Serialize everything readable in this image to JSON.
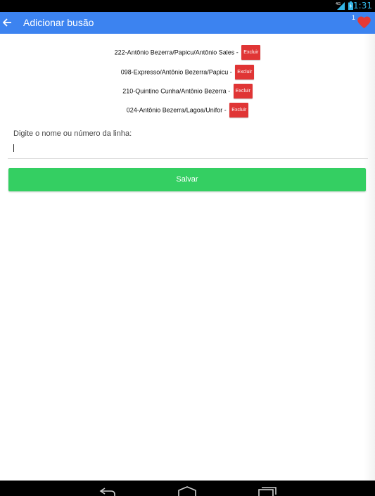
{
  "status_bar": {
    "network_label": "4G",
    "time": "1:31"
  },
  "app_bar": {
    "back_icon": "arrow-left-icon",
    "title": "Adicionar busão",
    "favorite_count": "1",
    "favorite_icon": "heart-icon"
  },
  "bus_lines": [
    {
      "name": "222-Antônio Bezerra/Papicu/Antônio Sales -",
      "delete_label": "Excluir"
    },
    {
      "name": "098-Expresso/Antônio Bezerra/Papicu -",
      "delete_label": "Excluir"
    },
    {
      "name": "210-Quintino Cunha/Antônio Bezerra -",
      "delete_label": "Excluir"
    },
    {
      "name": "024-Antônio Bezerra/Lagoa/Unifor -",
      "delete_label": "Excluir"
    }
  ],
  "form": {
    "label": "Digite o nome ou número da linha:",
    "value": "",
    "save_label": "Salvar"
  },
  "colors": {
    "app_bar": "#3c83f0",
    "delete_button": "#e03535",
    "save_button": "#34cf62",
    "heart": "#e53935",
    "status_icons": "#33b5e5"
  },
  "nav_bar": {
    "icons": [
      "back-nav-icon",
      "home-nav-icon",
      "recents-nav-icon"
    ]
  }
}
